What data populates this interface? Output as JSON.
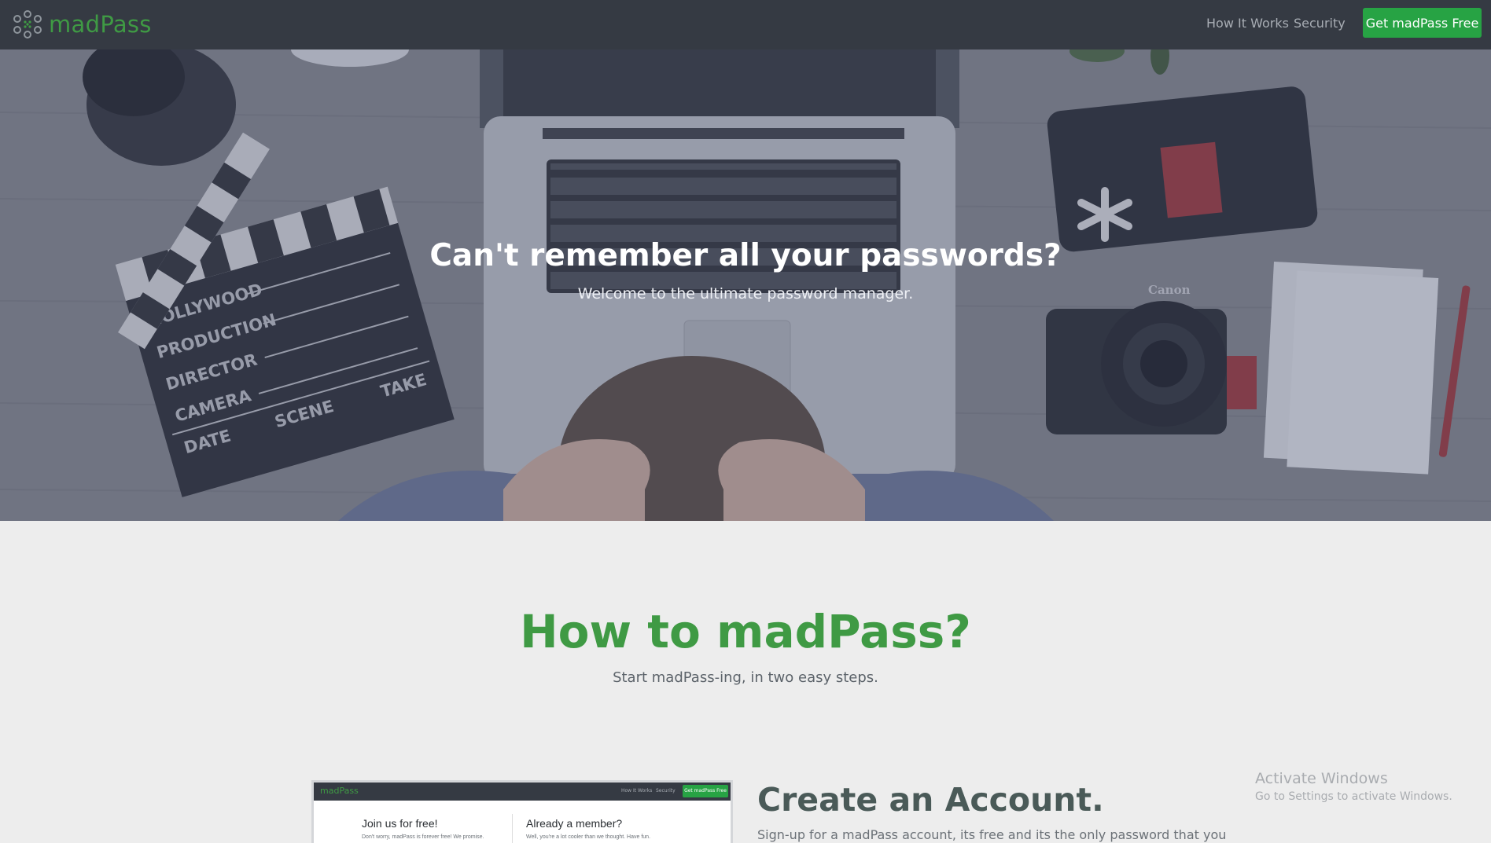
{
  "nav": {
    "brand": "madPass",
    "logo_icon": "network-dots-icon",
    "links": [
      "How It Works",
      "Security"
    ],
    "cta": "Get madPass Free"
  },
  "hero": {
    "title": "Can't remember all your passwords?",
    "subtitle": "Welcome to the ultimate password manager.",
    "clapboard_lines": [
      "HOLLYWOOD",
      "PRODUCTION",
      "DIRECTOR",
      "CAMERA",
      "DATE",
      "SCENE",
      "TAKE"
    ],
    "camera_brand": "Canon"
  },
  "how": {
    "title": "How to madPass?",
    "subtitle": "Start madPass-ing, in two easy steps."
  },
  "step1": {
    "title": "Create an Account.",
    "description": "Sign-up for a madPass account, its free and its the only password that you",
    "screenshot": {
      "brand": "madPass",
      "links": [
        "How It Works",
        "Security"
      ],
      "cta": "Get madPass Free",
      "left_heading": "Join us for free!",
      "left_text": "Don't worry, madPass is forever free! We promise.",
      "right_heading": "Already a member?",
      "right_text": "Well, you're a lot cooler than we thought. Have fun."
    }
  },
  "watermark": {
    "title": "Activate Windows",
    "subtitle": "Go to Settings to activate Windows."
  },
  "colors": {
    "nav_bg": "#353a43",
    "brand_green": "#3f9a44",
    "cta_green": "#27a344",
    "page_bg": "#ededed"
  }
}
